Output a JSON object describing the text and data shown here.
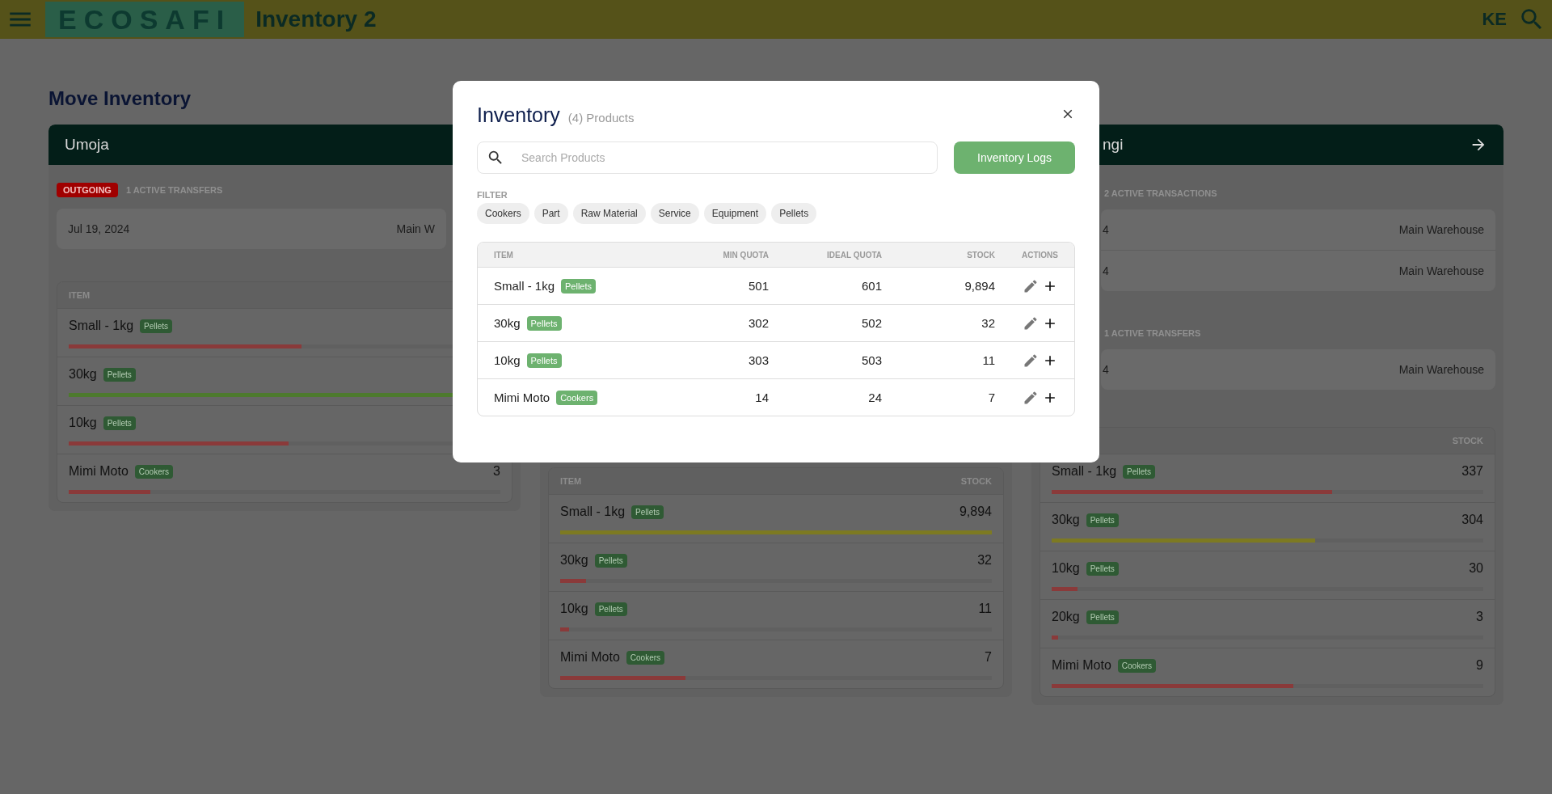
{
  "header": {
    "logo": "ECOSAFI",
    "title": "Inventory 2",
    "user": "KE"
  },
  "page_title": "Move Inventory",
  "columns": [
    {
      "name": "Umoja",
      "nav_arrow": false,
      "sections": [
        {
          "badge": "OUTGOING",
          "count": "1 ACTIVE TRANSFERS",
          "transfers": [
            {
              "date": "Jul 19, 2024",
              "location": "Main W"
            }
          ]
        }
      ],
      "table": {
        "item_header": "ITEM",
        "rows": [
          {
            "item": "Small - 1kg",
            "tag": "Pellets",
            "level": 0.54,
            "color": "#8a3a3a"
          },
          {
            "item": "30kg",
            "tag": "Pellets",
            "level": 1,
            "color": "#4d7a2e"
          },
          {
            "item": "10kg",
            "tag": "Pellets",
            "level": 0.51,
            "color": "#8a3a3a"
          },
          {
            "item": "Mimi Moto",
            "tag": "Cookers",
            "stock": "3",
            "level": 0.19,
            "color": "#8a3a3a"
          }
        ]
      }
    },
    {
      "table": {
        "item_header": "ITEM",
        "stock_header": "STOCK",
        "rows": [
          {
            "item": "Small - 1kg",
            "tag": "Pellets",
            "stock": "9,894",
            "level": 1,
            "color": "#7d7a22"
          },
          {
            "item": "30kg",
            "tag": "Pellets",
            "stock": "32",
            "level": 0.06,
            "color": "#8a3a3a"
          },
          {
            "item": "10kg",
            "tag": "Pellets",
            "stock": "11",
            "level": 0.02,
            "color": "#8a3a3a"
          },
          {
            "item": "Mimi Moto",
            "tag": "Cookers",
            "stock": "7",
            "level": 0.29,
            "color": "#8a3a3a"
          }
        ]
      }
    },
    {
      "name": "ngi",
      "nav_arrow": true,
      "sections": [
        {
          "count": "2 ACTIVE TRANSACTIONS",
          "transfers": [
            {
              "date": "4",
              "location": "Main Warehouse"
            },
            {
              "date": "4",
              "location": "Main Warehouse"
            }
          ]
        },
        {
          "count": "1 ACTIVE TRANSFERS",
          "transfers": [
            {
              "date": "4",
              "location": "Main Warehouse"
            }
          ]
        }
      ],
      "table": {
        "stock_header": "STOCK",
        "rows": [
          {
            "item": "Small - 1kg",
            "tag": "Pellets",
            "stock": "337",
            "level": 0.65,
            "color": "#8a3a3a"
          },
          {
            "item": "30kg",
            "tag": "Pellets",
            "stock": "304",
            "level": 0.61,
            "color": "#7d7a22"
          },
          {
            "item": "10kg",
            "tag": "Pellets",
            "stock": "30",
            "level": 0.06,
            "color": "#8a3a3a"
          },
          {
            "item": "20kg",
            "tag": "Pellets",
            "stock": "3",
            "level": 0.015,
            "color": "#8a3a3a"
          },
          {
            "item": "Mimi Moto",
            "tag": "Cookers",
            "stock": "9",
            "level": 0.56,
            "color": "#8a3a3a"
          }
        ]
      }
    }
  ],
  "modal": {
    "title": "Inventory",
    "subtitle": "(4) Products",
    "search": {
      "placeholder": "Search Products"
    },
    "logs_button": "Inventory Logs",
    "filter_label": "FILTER",
    "filters": [
      {
        "label": "Cookers",
        "selected": false
      },
      {
        "label": "Part",
        "selected": false
      },
      {
        "label": "Raw Material",
        "selected": false
      },
      {
        "label": "Service",
        "selected": false
      },
      {
        "label": "Equipment",
        "selected": false
      },
      {
        "label": "Pellets",
        "selected": false
      }
    ],
    "table": {
      "columns": [
        "ITEM",
        "MIN QUOTA",
        "IDEAL QUOTA",
        "STOCK",
        "ACTIONS"
      ],
      "rows": [
        {
          "item": "Small - 1kg",
          "tag": "Pellets",
          "min_quota": "501",
          "ideal_quota": "601",
          "stock": "9,894"
        },
        {
          "item": "30kg",
          "tag": "Pellets",
          "min_quota": "302",
          "ideal_quota": "502",
          "stock": "32"
        },
        {
          "item": "10kg",
          "tag": "Pellets",
          "min_quota": "303",
          "ideal_quota": "503",
          "stock": "11"
        },
        {
          "item": "Mimi Moto",
          "tag": "Cookers",
          "min_quota": "14",
          "ideal_quota": "24",
          "stock": "7"
        }
      ]
    }
  }
}
